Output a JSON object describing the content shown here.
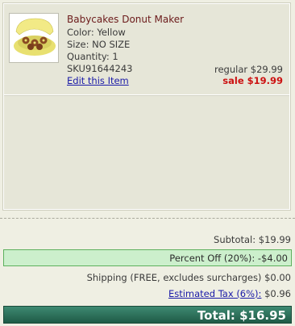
{
  "item": {
    "name": "Babycakes Donut Maker",
    "color": "Color: Yellow",
    "size": "Size: NO SIZE",
    "quantity": "Quantity: 1",
    "sku": "SKU91644243",
    "edit_label": "Edit this Item",
    "regular_price": "regular $29.99",
    "sale_price": "sale $19.99",
    "image_icon": "donut-maker-product-image"
  },
  "summary": {
    "subtotal": "Subtotal: $19.99",
    "discount": "Percent Off (20%): -$4.00",
    "shipping": "Shipping (FREE, excludes surcharges) $0.00",
    "tax_label": "Estimated Tax (6%):",
    "tax_value": " $0.96",
    "total": "Total: $16.95"
  },
  "colors": {
    "sale": "#cc1111",
    "link": "#1a1aa8",
    "item_name": "#6b1a1a",
    "discount_bg": "#ccefcc",
    "total_bar": "#2d7059"
  }
}
